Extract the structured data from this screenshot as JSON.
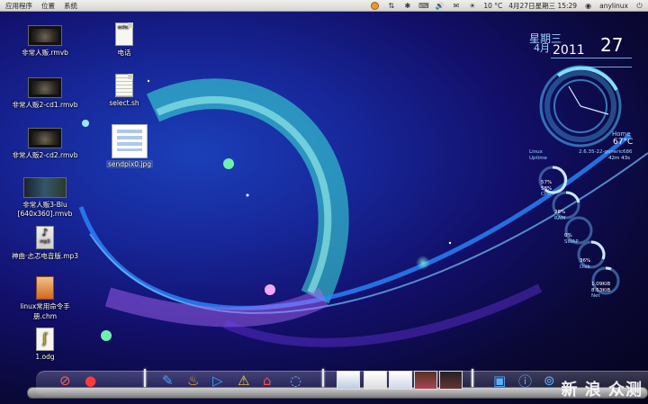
{
  "top_panel": {
    "menus": [
      "应用程序",
      "位置",
      "系统"
    ],
    "weather": "10 °C",
    "datetime": "4月27日星期三 15:29",
    "user": "anylinux"
  },
  "desktop_icons": [
    {
      "label": "非常人贩.rmvb",
      "type": "video"
    },
    {
      "label": "非常人贩2-cd1.rmvb",
      "type": "video"
    },
    {
      "label": "非常人贩2-cd2.rmvb",
      "type": "video"
    },
    {
      "label": "非常人贩3-Blu [640x360].rmvb",
      "type": "video"
    },
    {
      "label": "神曲·忐忑电音版.mp3",
      "type": "audio",
      "tag": "mp3"
    },
    {
      "label": "linux常用命令手册.chm",
      "type": "chm"
    },
    {
      "label": "1.odg",
      "type": "drawing"
    },
    {
      "label": "电话",
      "type": "text",
      "tag": "echo"
    },
    {
      "label": "select.sh",
      "type": "script"
    },
    {
      "label": "sendpix0.jpg",
      "type": "image"
    }
  ],
  "conky": {
    "weekday": "星期三",
    "month": "4月",
    "year": "2011",
    "day": "27",
    "home_label": "Home",
    "temperature": "67°C",
    "kernel": "2.6.35-22-generic686",
    "uptime": "42m 43s",
    "linux_label": "Linux",
    "uptime_label": "Uptime",
    "cpu": [
      "57%",
      "58%"
    ],
    "cpu_label": "CPU",
    "ram": "28%",
    "ram_label": "RAM",
    "swap": "0%",
    "swap_label": "SWAP",
    "disk": "36%",
    "disk_label": "Disk",
    "net": [
      "1.09KiB",
      "8.53KiB"
    ],
    "net_label": "Net"
  },
  "watermark": "新 浪 众测",
  "colors": {
    "accent": "#9fd8ff",
    "panel": "#e3e2de"
  }
}
